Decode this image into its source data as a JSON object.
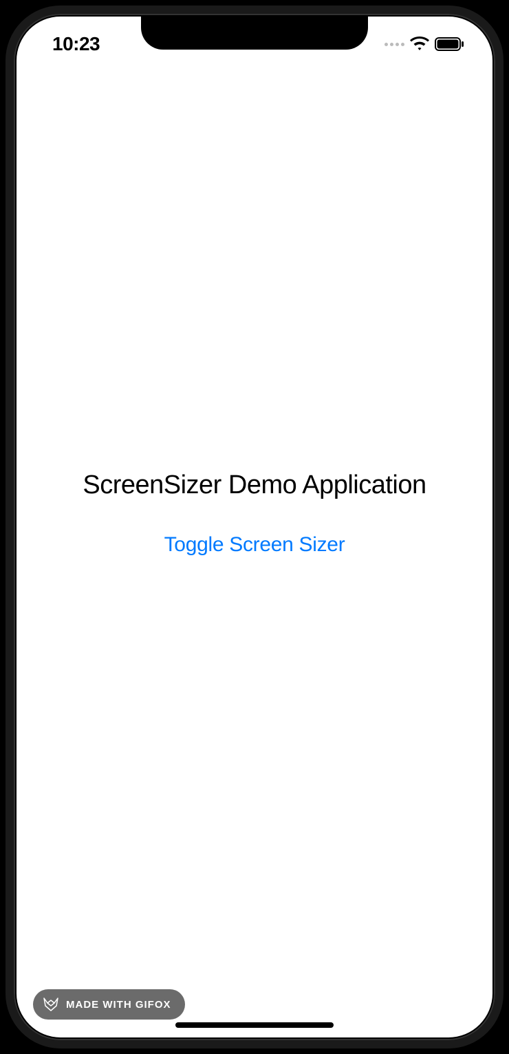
{
  "status_bar": {
    "time": "10:23"
  },
  "app": {
    "title": "ScreenSizer Demo Application",
    "toggle_button_label": "Toggle Screen Sizer"
  },
  "badge": {
    "text": "MADE WITH GIFOX"
  }
}
